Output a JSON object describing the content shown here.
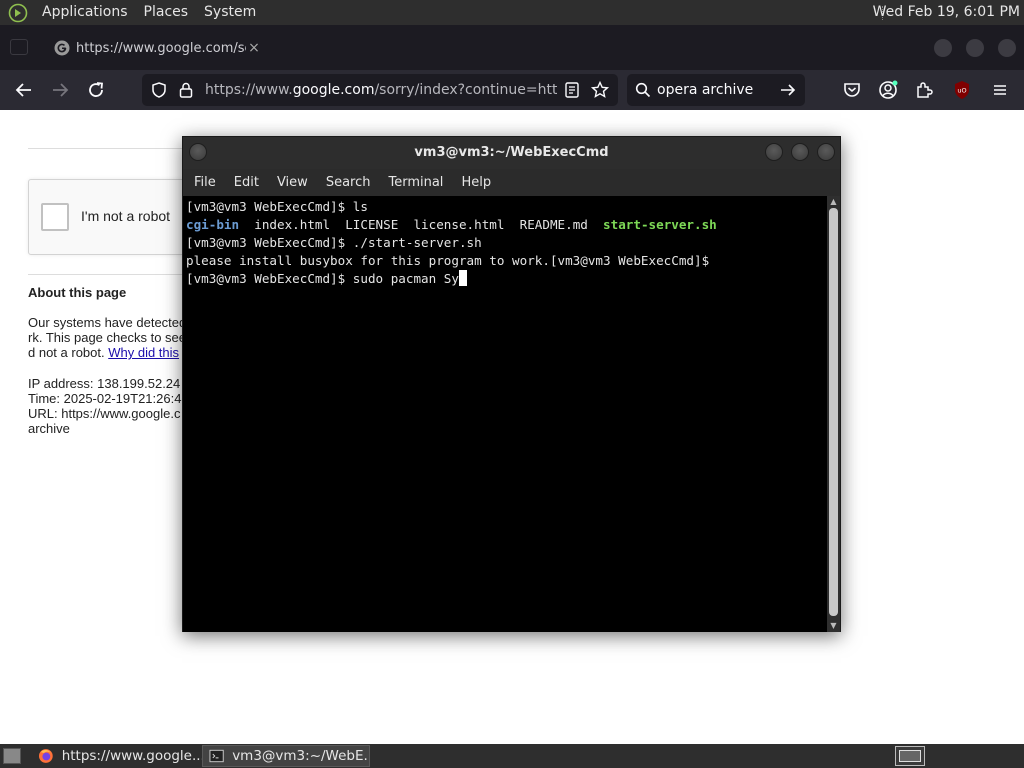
{
  "desktop": {
    "menus": [
      "Applications",
      "Places",
      "System"
    ],
    "clock": "Wed Feb 19,  6:01 PM"
  },
  "browser": {
    "tab_title": "https://www.google.com/se",
    "tab_close": "×",
    "url_prefix": "https://www.",
    "url_domain": "google.com",
    "url_suffix": "/sorry/index?continue=https://v",
    "search_text": "opera archive"
  },
  "page": {
    "captcha_label": "I'm not a robot",
    "about_title": "About this page",
    "about_line1": "Our systems have detected",
    "about_line2": "rk. This page checks to see",
    "about_line3": "d not a robot. ",
    "about_link": "Why did this",
    "ip_line": "IP address: 138.199.52.24",
    "time_line": "Time: 2025-02-19T21:26:4",
    "url_line": "URL: https://www.google.c",
    "url_line2": "archive"
  },
  "terminal": {
    "title": "vm3@vm3:~/WebExecCmd",
    "menu": [
      "File",
      "Edit",
      "View",
      "Search",
      "Terminal",
      "Help"
    ],
    "prompt1": "[vm3@vm3 WebExecCmd]$ ls",
    "ls_dir": "cgi-bin",
    "ls_files": "  index.html  LICENSE  license.html  README.md  ",
    "ls_exe": "start-server.sh",
    "prompt2": "[vm3@vm3 WebExecCmd]$ ./start-server.sh",
    "output1": "please install busybox for this program to work.[vm3@vm3 WebExecCmd]$",
    "prompt3": "[vm3@vm3 WebExecCmd]$ sudo pacman Sy"
  },
  "taskbar": {
    "task1": "https://www.google...",
    "task2": "vm3@vm3:~/WebE..."
  },
  "colors": {
    "panel": "#2e2e2e",
    "browser_chrome": "#2b2a33",
    "terminal_bg": "#000000",
    "dir_color": "#6b9bd2",
    "exe_color": "#7ed957"
  }
}
